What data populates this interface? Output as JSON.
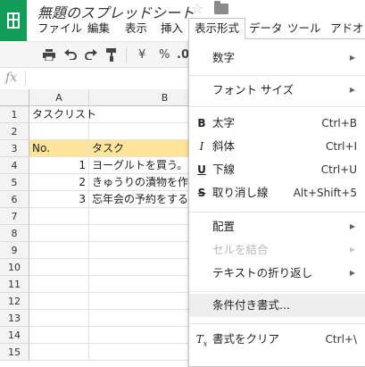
{
  "header": {
    "title": "無題のスプレッドシート",
    "star_icon": "☆",
    "folder_icon": "folder-icon"
  },
  "menu": [
    {
      "label": "ファイル"
    },
    {
      "label": "編集"
    },
    {
      "label": "表示"
    },
    {
      "label": "挿入"
    },
    {
      "label": "表示形式"
    },
    {
      "label": "データ"
    },
    {
      "label": "ツール"
    },
    {
      "label": "アドオ"
    }
  ],
  "toolbar": {
    "currency": "¥",
    "percent": "%",
    "decimal": ".0"
  },
  "formula_bar": {
    "fx": "fx",
    "value": ""
  },
  "grid": {
    "columns": [
      "A",
      "B"
    ],
    "rows": [
      "1",
      "2",
      "3",
      "4",
      "5",
      "6",
      "7",
      "8",
      "9",
      "10",
      "11",
      "12",
      "13",
      "14",
      "15"
    ],
    "cells": {
      "A1": "タスクリスト",
      "A3": "No.",
      "B3": "タスク",
      "A4": "1",
      "B4": "ヨーグルトを買う。",
      "A5": "2",
      "B5": "きゅうりの漬物を作る。",
      "A6": "3",
      "B6": "忘年会の予約をする。"
    },
    "header_fill": "#ffe599"
  },
  "format_menu": {
    "number": "数字",
    "font_size": "フォント サイズ",
    "bold": "太字",
    "bold_shortcut": "Ctrl+B",
    "italic": "斜体",
    "italic_shortcut": "Ctrl+I",
    "underline": "下線",
    "underline_shortcut": "Ctrl+U",
    "strike": "取り消し線",
    "strike_shortcut": "Alt+Shift+5",
    "align": "配置",
    "merge": "セルを結合",
    "wrap": "テキストの折り返し",
    "conditional": "条件付き書式...",
    "clear": "書式をクリア",
    "clear_shortcut": "Ctrl+\\"
  }
}
